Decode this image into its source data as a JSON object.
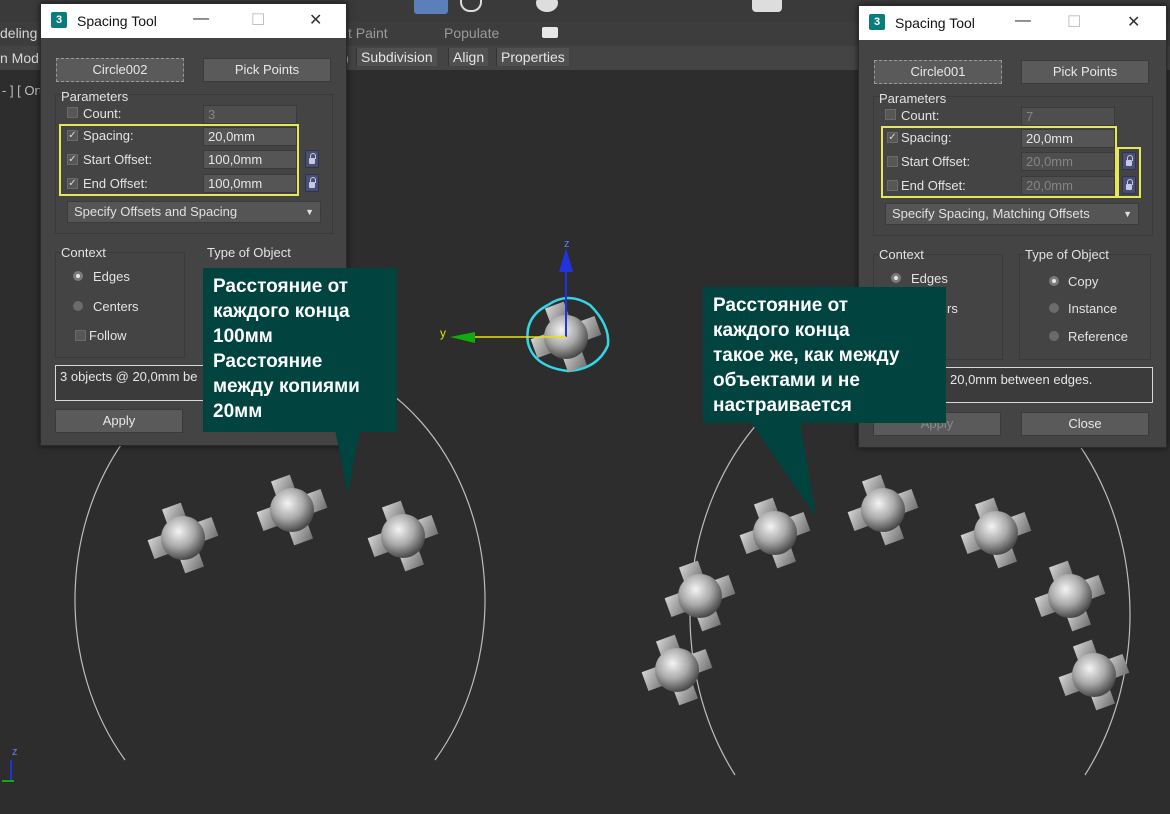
{
  "toolbar": {
    "tab_modeling": "deling",
    "tab_mod": "n Mod",
    "tab_paint": "t Paint",
    "tab_populate": "Populate",
    "paren": ")",
    "subdivision": "Subdivision",
    "align": "Align",
    "properties": "Properties"
  },
  "viewport": {
    "label": "- ] [ Ort",
    "gizmo_z": "z",
    "gizmo_y": "y",
    "corner_z": "z"
  },
  "dialog_left": {
    "title": "Spacing Tool",
    "app_icon": "3",
    "pick_path_label": "Circle002",
    "pick_points_label": "Pick Points",
    "parameters_label": "Parameters",
    "count_label": "Count:",
    "count_value": "3",
    "spacing_label": "Spacing:",
    "spacing_value": "20,0mm",
    "start_offset_label": "Start Offset:",
    "start_offset_value": "100,0mm",
    "end_offset_label": "End Offset:",
    "end_offset_value": "100,0mm",
    "mode": "Specify Offsets and Spacing",
    "context_label": "Context",
    "edges_label": "Edges",
    "centers_label": "Centers",
    "follow_label": "Follow",
    "type_label": "Type of Object",
    "status": "3 objects @ 20,0mm  be",
    "apply_label": "Apply"
  },
  "dialog_right": {
    "title": "Spacing Tool",
    "app_icon": "3",
    "pick_path_label": "Circle001",
    "pick_points_label": "Pick Points",
    "parameters_label": "Parameters",
    "count_label": "Count:",
    "count_value": "7",
    "spacing_label": "Spacing:",
    "spacing_value": "20,0mm",
    "start_offset_label": "Start Offset:",
    "start_offset_value": "20,0mm",
    "end_offset_label": "End Offset:",
    "end_offset_value": "20,0mm",
    "mode": "Specify Spacing, Matching Offsets",
    "context_label": "Context",
    "edges_label": "Edges",
    "centers_label": "rs",
    "type_label": "Type of Object",
    "copy_label": "Copy",
    "instance_label": "Instance",
    "reference_label": "Reference",
    "status": "20,0mm  between edges.",
    "apply_label": "Apply",
    "close_label": "Close"
  },
  "callout_left": {
    "lines": [
      "Расстояние от",
      "каждого конца",
      "100мм",
      "Расстояние",
      "между копиями",
      "20мм"
    ]
  },
  "callout_right": {
    "lines": [
      "Расстояние от",
      "каждого конца",
      "такое же, как между",
      "объектами и не",
      "настраивается"
    ]
  },
  "colors": {
    "highlight": "#e6e65a",
    "callout_bg": "#00433f",
    "selection": "#33d6e6"
  }
}
